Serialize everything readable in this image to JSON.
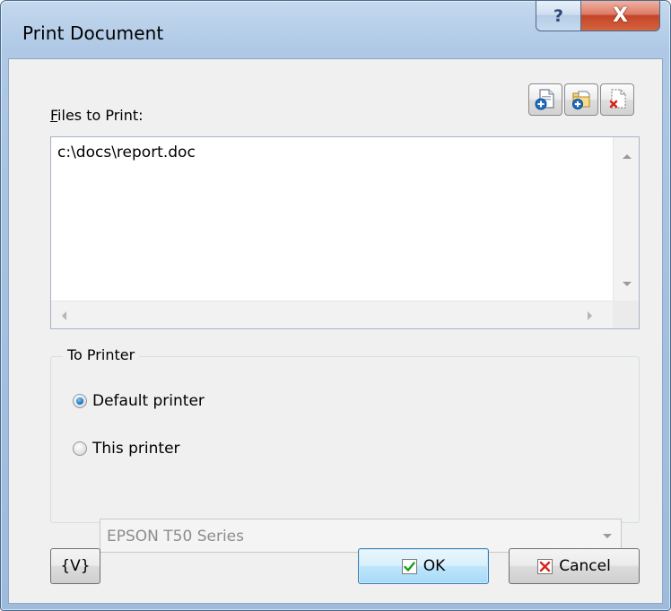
{
  "window": {
    "title": "Print Document",
    "help_glyph": "?",
    "close_glyph": "X"
  },
  "files": {
    "label_prefix": "F",
    "label_rest": "iles to Print:",
    "items": [
      "c:\\docs\\report.doc"
    ],
    "toolbar": [
      {
        "name": "add-file-icon"
      },
      {
        "name": "add-folder-icon"
      },
      {
        "name": "remove-file-icon"
      }
    ]
  },
  "printer": {
    "group_label": "To Printer",
    "option_default": "Default printer",
    "option_this": "This printer",
    "selected": "default",
    "printer_value": "EPSON T50 Series"
  },
  "buttons": {
    "variables_label": "{V}",
    "ok_label": "OK",
    "cancel_label": "Cancel"
  },
  "colors": {
    "ok_check": "#1aa01a",
    "cancel_x": "#d8231b",
    "icon_blue": "#1f6fc4"
  }
}
